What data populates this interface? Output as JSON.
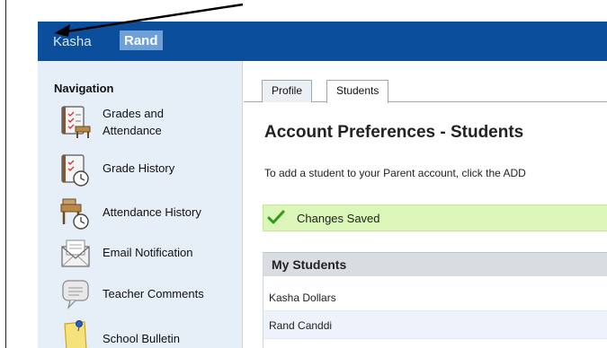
{
  "header": {
    "student_first": "Kasha",
    "student_second": "Rand"
  },
  "navigation": {
    "heading": "Navigation",
    "items": [
      {
        "label_line1": "Grades and",
        "label_line2": "Attendance",
        "icon": "grades-attendance-icon"
      },
      {
        "label": "Grade History",
        "icon": "grade-history-icon"
      },
      {
        "label": "Attendance History",
        "icon": "attendance-history-icon"
      },
      {
        "label": "Email Notification",
        "icon": "email-notification-icon"
      },
      {
        "label": "Teacher Comments",
        "icon": "teacher-comments-icon"
      },
      {
        "label": "School Bulletin",
        "icon": "school-bulletin-icon"
      }
    ]
  },
  "tabs": [
    {
      "label": "Profile",
      "active": false
    },
    {
      "label": "Students",
      "active": true
    }
  ],
  "main": {
    "title": "Account Preferences - Students",
    "instructions": "To add a student to your Parent account, click the ADD",
    "saved_message": "Changes Saved"
  },
  "students": {
    "header": "My Students",
    "rows": [
      "Kasha Dollars",
      "Rand Canddi"
    ]
  },
  "colors": {
    "topbar": "#0b4f9c",
    "sidebar": "#e6eef8",
    "saved_bg": "#dcf5b8",
    "check": "#2e9a1c"
  }
}
